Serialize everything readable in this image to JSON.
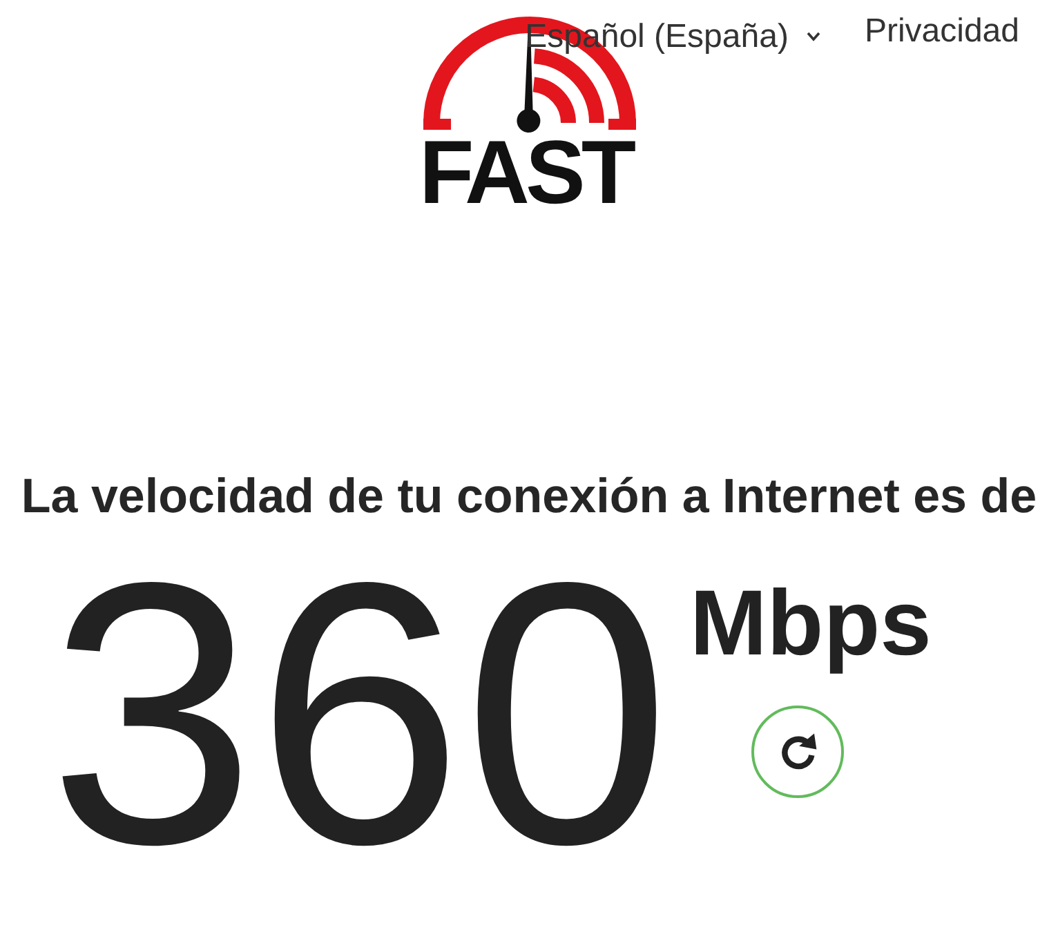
{
  "header": {
    "logo_text": "FAST",
    "language_selector": {
      "label": "Español (España)"
    },
    "links": [
      {
        "label": "Privacidad"
      }
    ]
  },
  "result": {
    "heading": "La velocidad de tu conexión a Internet es de",
    "speed": "360",
    "unit": "Mbps"
  }
}
